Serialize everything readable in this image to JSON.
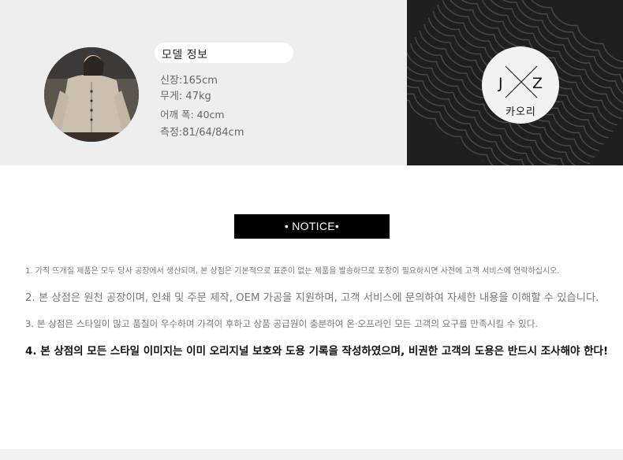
{
  "model": {
    "title": "모델 정보",
    "height": "신장:165cm",
    "weight": "무게: 47kg",
    "shoulder": "어깨 폭: 40cm",
    "measurements": "측정:81/64/84cm"
  },
  "brand": {
    "letter_left": "J",
    "letter_right": "Z",
    "name": "카오리"
  },
  "notice": {
    "header": "• NOTICE•",
    "items": [
      "1. 가직 뜨개질 제품은 모두 당사 공장에서 생산되며, 본 상점은 기본적으로 표준이 없는 제품을 발송하므로 포장이 필요하시면 사전에 고객 서비스에 연락하십시오.",
      "2. 본 상점은 원천 공장이며, 인쇄 및 주문 제작, OEM 가공을 지원하며, 고객 서비스에 문의하여 자세한 내용을 이해할 수 있습니다.",
      "3. 본 상점은 스타일이 많고 품질이 우수하며 가격이 후하고 상품 공급원이 충분하여 온·오프라인 모든 고객의 요구를 만족시킬 수 있다.",
      "4. 본 상점의 모든 스타일 이미지는 이미 오리지널 보호와 도용 기록을 작성하였으며, 비권한 고객의 도용은 반드시 조사해야 한다!"
    ]
  },
  "colors": {
    "top_band": "#eeeeee",
    "pattern_bg": "#1f1f1f",
    "notice_bar": "#000000"
  }
}
